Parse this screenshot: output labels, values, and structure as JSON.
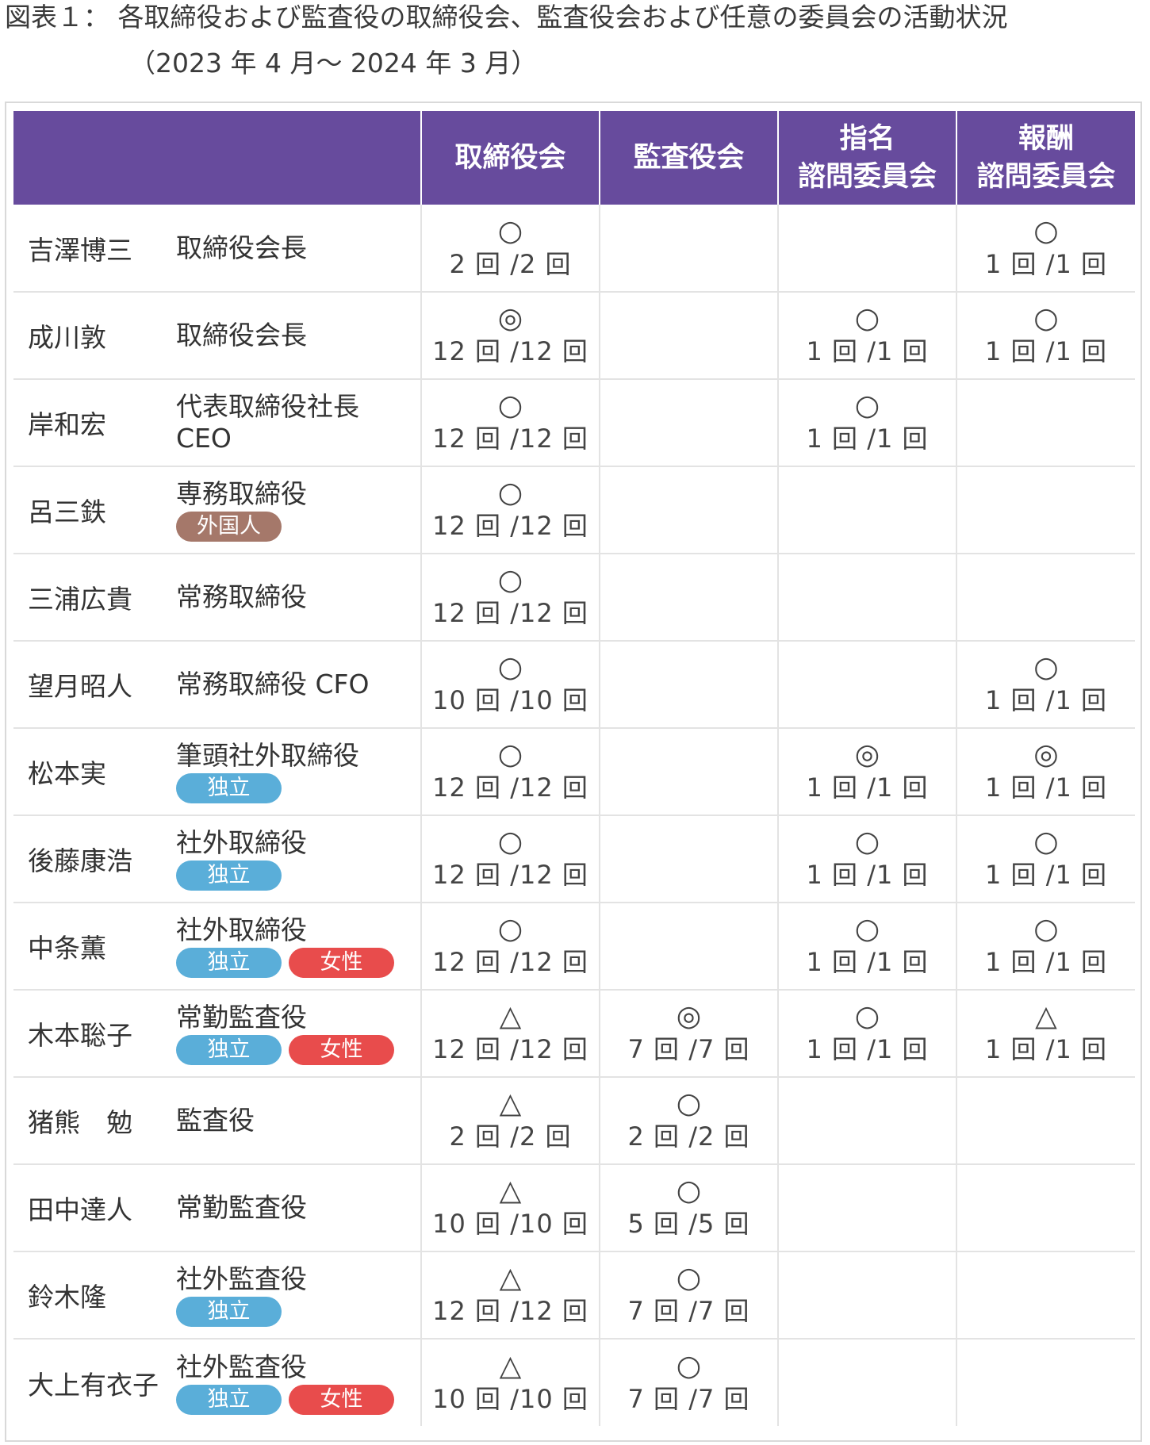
{
  "title": {
    "line1": "図表１： 各取締役および監査役の取締役会、監査役会および任意の委員会の活動状況",
    "line2": "（2023 年 4 月〜 2024 年 3 月）"
  },
  "colors": {
    "header_bg": "#674b9d",
    "badge_独立": "#5aaed9",
    "badge_女性": "#e84c4c",
    "badge_外国人": "#a5786a"
  },
  "columns": [
    "取締役会",
    "監査役会",
    "指名\n諮問委員会",
    "報酬\n諮問委員会"
  ],
  "rows": [
    {
      "name": "吉澤博三",
      "role": "取締役会長",
      "badges": [],
      "cells": [
        {
          "mark": "○",
          "count": "2 回 /2 回"
        },
        null,
        null,
        {
          "mark": "○",
          "count": "1 回 /1 回"
        }
      ]
    },
    {
      "name": "成川敦",
      "role": "取締役会長",
      "badges": [],
      "cells": [
        {
          "mark": "◎",
          "count": "12 回 /12 回"
        },
        null,
        {
          "mark": "○",
          "count": "1 回 /1 回"
        },
        {
          "mark": "○",
          "count": "1 回 /1 回"
        }
      ]
    },
    {
      "name": "岸和宏",
      "role": "代表取締役社長\nCEO",
      "badges": [],
      "cells": [
        {
          "mark": "○",
          "count": "12 回 /12 回"
        },
        null,
        {
          "mark": "○",
          "count": "1 回 /1 回"
        },
        null
      ]
    },
    {
      "name": "呂三鉄",
      "role": "専務取締役",
      "badges": [
        "外国人"
      ],
      "cells": [
        {
          "mark": "○",
          "count": "12 回 /12 回"
        },
        null,
        null,
        null
      ]
    },
    {
      "name": "三浦広貴",
      "role": "常務取締役",
      "badges": [],
      "cells": [
        {
          "mark": "○",
          "count": "12 回 /12 回"
        },
        null,
        null,
        null
      ]
    },
    {
      "name": "望月昭人",
      "role": "常務取締役 CFO",
      "badges": [],
      "cells": [
        {
          "mark": "○",
          "count": "10 回 /10 回"
        },
        null,
        null,
        {
          "mark": "○",
          "count": "1 回 /1 回"
        }
      ]
    },
    {
      "name": "松本実",
      "role": "筆頭社外取締役",
      "badges": [
        "独立"
      ],
      "cells": [
        {
          "mark": "○",
          "count": "12 回 /12 回"
        },
        null,
        {
          "mark": "◎",
          "count": "1 回 /1 回"
        },
        {
          "mark": "◎",
          "count": "1 回 /1 回"
        }
      ]
    },
    {
      "name": "後藤康浩",
      "role": "社外取締役",
      "badges": [
        "独立"
      ],
      "cells": [
        {
          "mark": "○",
          "count": "12 回 /12 回"
        },
        null,
        {
          "mark": "○",
          "count": "1 回 /1 回"
        },
        {
          "mark": "○",
          "count": "1 回 /1 回"
        }
      ]
    },
    {
      "name": "中条薫",
      "role": "社外取締役",
      "badges": [
        "独立",
        "女性"
      ],
      "cells": [
        {
          "mark": "○",
          "count": "12 回 /12 回"
        },
        null,
        {
          "mark": "○",
          "count": "1 回 /1 回"
        },
        {
          "mark": "○",
          "count": "1 回 /1 回"
        }
      ]
    },
    {
      "name": "木本聡子",
      "role": "常勤監査役",
      "badges": [
        "独立",
        "女性"
      ],
      "cells": [
        {
          "mark": "△",
          "count": "12 回 /12 回"
        },
        {
          "mark": "◎",
          "count": "7 回 /7 回"
        },
        {
          "mark": "○",
          "count": "1 回 /1 回"
        },
        {
          "mark": "△",
          "count": "1 回 /1 回"
        }
      ]
    },
    {
      "name": "猪熊　勉",
      "role": "監査役",
      "badges": [],
      "cells": [
        {
          "mark": "△",
          "count": "2 回 /2 回"
        },
        {
          "mark": "○",
          "count": "2 回 /2 回"
        },
        null,
        null
      ]
    },
    {
      "name": "田中達人",
      "role": "常勤監査役",
      "badges": [],
      "cells": [
        {
          "mark": "△",
          "count": "10 回 /10 回"
        },
        {
          "mark": "○",
          "count": "5 回 /5 回"
        },
        null,
        null
      ]
    },
    {
      "name": "鈴木隆",
      "role": "社外監査役",
      "badges": [
        "独立"
      ],
      "cells": [
        {
          "mark": "△",
          "count": "12 回 /12 回"
        },
        {
          "mark": "○",
          "count": "7 回 /7 回"
        },
        null,
        null
      ]
    },
    {
      "name": "大上有衣子",
      "role": "社外監査役",
      "badges": [
        "独立",
        "女性"
      ],
      "cells": [
        {
          "mark": "△",
          "count": "10 回 /10 回"
        },
        {
          "mark": "○",
          "count": "7 回 /7 回"
        },
        null,
        null
      ]
    }
  ]
}
